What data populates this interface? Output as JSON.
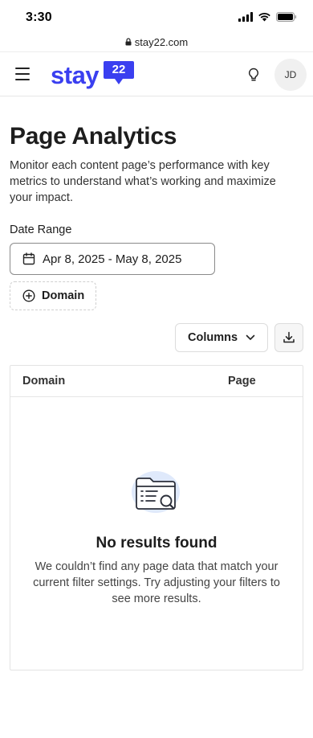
{
  "status_bar": {
    "time": "3:30"
  },
  "browser": {
    "url": "stay22.com"
  },
  "header": {
    "logo_text": "stay",
    "logo_badge": "22",
    "avatar_initials": "JD",
    "brand_color": "#3a3ff0"
  },
  "main": {
    "title": "Page Analytics",
    "description": "Monitor each content page’s performance with key metrics to understand what’s working and maximize your impact.",
    "date_range": {
      "label": "Date Range",
      "value": "Apr 8, 2025 - May 8, 2025",
      "icon": "calendar-icon"
    },
    "domain_filter": {
      "label": "Domain",
      "icon": "plus-circle-icon"
    },
    "columns_button": {
      "label": "Columns",
      "icon": "chevron-down-icon"
    },
    "download_button": {
      "icon": "download-icon"
    },
    "table": {
      "columns": [
        "Domain",
        "Page"
      ],
      "empty_state": {
        "icon": "folder-search-icon",
        "title": "No results found",
        "message": "We couldn’t find any page data that match your current filter settings. Try adjusting your filters to see more results."
      }
    }
  }
}
